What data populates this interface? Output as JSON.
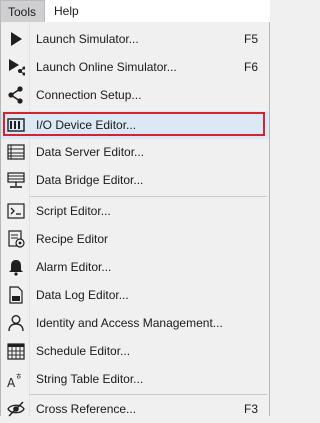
{
  "menubar": {
    "tools": "Tools",
    "help": "Help"
  },
  "menu": {
    "items": [
      {
        "label": "Launch Simulator...",
        "shortcut": "F5",
        "icon": "play-icon"
      },
      {
        "label": "Launch Online Simulator...",
        "shortcut": "F6",
        "icon": "online-simulator-icon"
      },
      {
        "label": "Connection Setup...",
        "shortcut": "",
        "icon": "share-nodes-icon"
      },
      {
        "label": "I/O Device Editor...",
        "shortcut": "",
        "icon": "io-device-icon",
        "selected": true
      },
      {
        "label": "Data Server Editor...",
        "shortcut": "",
        "icon": "data-server-icon"
      },
      {
        "label": "Data Bridge Editor...",
        "shortcut": "",
        "icon": "data-bridge-icon"
      },
      {
        "label": "Script Editor...",
        "shortcut": "",
        "icon": "script-icon"
      },
      {
        "label": "Recipe Editor",
        "shortcut": "",
        "icon": "recipe-icon"
      },
      {
        "label": "Alarm Editor...",
        "shortcut": "",
        "icon": "bell-icon"
      },
      {
        "label": "Data Log Editor...",
        "shortcut": "",
        "icon": "data-log-icon"
      },
      {
        "label": "Identity and Access Management...",
        "shortcut": "",
        "icon": "user-icon"
      },
      {
        "label": "Schedule Editor...",
        "shortcut": "",
        "icon": "calendar-icon"
      },
      {
        "label": "String Table Editor...",
        "shortcut": "",
        "icon": "string-table-icon"
      },
      {
        "label": "Cross Reference...",
        "shortcut": "F3",
        "icon": "cross-reference-icon"
      }
    ]
  },
  "colors": {
    "highlight_border": "#d4232c",
    "selected_background": "#dbe8f6"
  }
}
